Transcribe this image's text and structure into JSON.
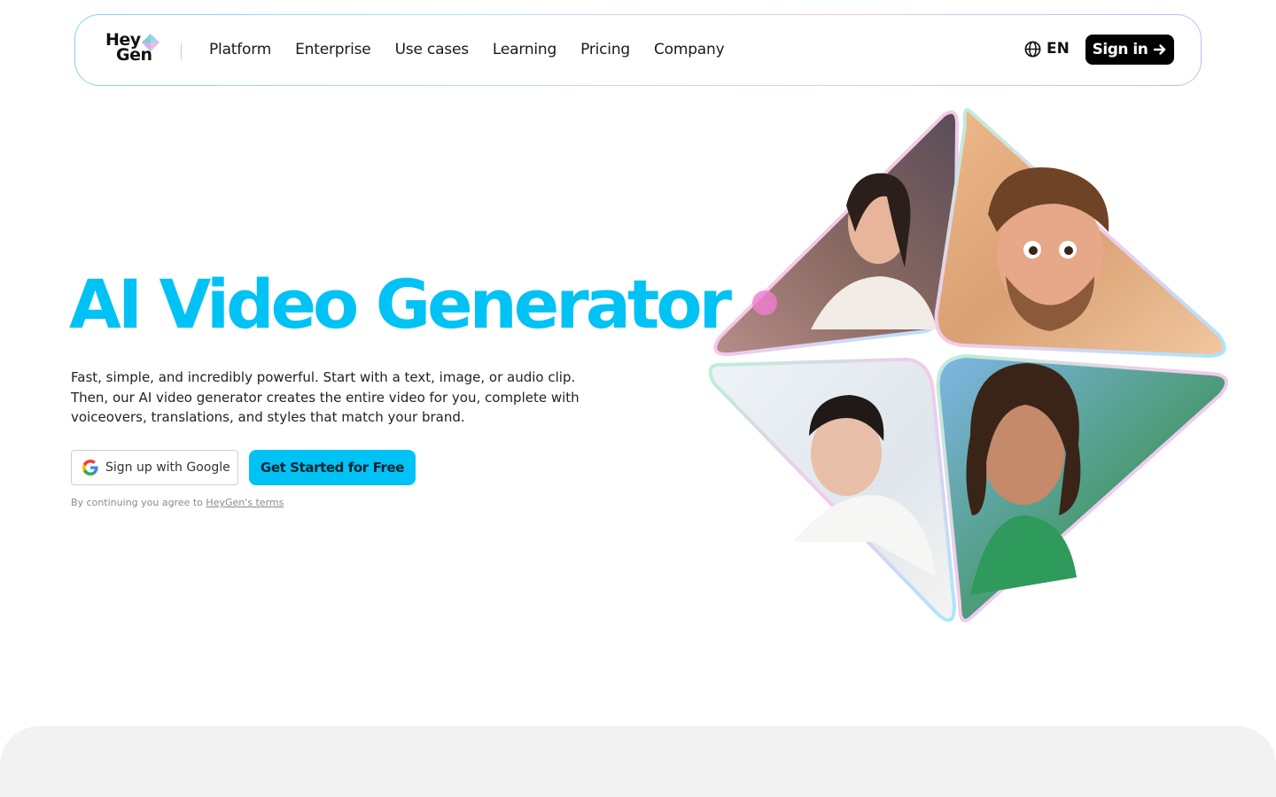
{
  "brand": {
    "line1": "Hey",
    "line2": "Gen"
  },
  "nav": {
    "links": [
      "Platform",
      "Enterprise",
      "Use cases",
      "Learning",
      "Pricing",
      "Company"
    ],
    "language": "EN",
    "signin_label": "Sign in"
  },
  "hero": {
    "title": "AI Video Generator",
    "description": "Fast, simple, and incredibly powerful. Start with a text, image, or audio clip. Then, our AI video generator creates the entire video for you, complete with voiceovers, translations, and styles that match your brand.",
    "google_label": "Sign up with Google",
    "cta_label": "Get Started for Free",
    "terms_prefix": "By continuing you agree to",
    "terms_link": "HeyGen's terms"
  },
  "colors": {
    "accent": "#00c2f5",
    "text": "#111111",
    "signin_bg": "#000000",
    "bottom_panel": "#f2f2f2"
  },
  "icons": {
    "language": "globe-icon",
    "signin": "arrow-right-icon",
    "google": "google-logo-icon"
  }
}
